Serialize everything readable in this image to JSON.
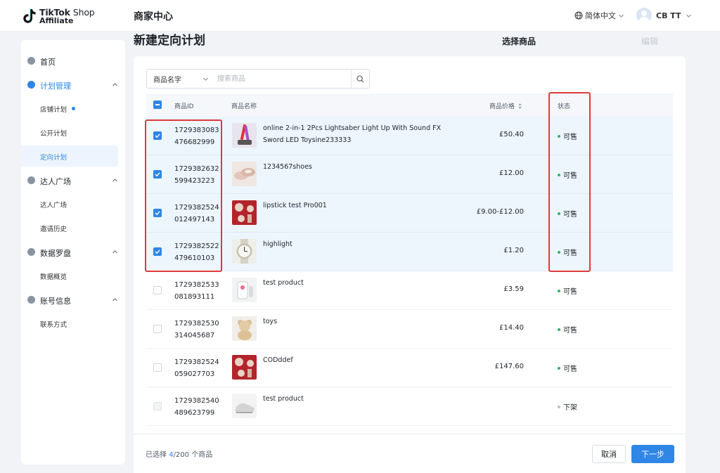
{
  "header": {
    "logo_line1_bold": "TikTok",
    "logo_line1_light": "Shop",
    "logo_line2": "Affiliate",
    "app_title": "商家中心",
    "language": "简体中文",
    "user_name": "CB TT"
  },
  "sidebar": {
    "home": "首页",
    "plan_mgmt": "计划管理",
    "plan_items": [
      "店铺计划",
      "公开计划",
      "定向计划"
    ],
    "creator_square": "达人广场",
    "creator_items": [
      "达人广场",
      "邀请历史"
    ],
    "data_compass": "数据罗盘",
    "data_items": [
      "数据概览"
    ],
    "account_info": "账号信息",
    "account_items": [
      "联系方式"
    ]
  },
  "page": {
    "title": "新建定向计划",
    "step_active": "选择商品",
    "step_next": "编辑"
  },
  "search": {
    "field_select": "商品名字",
    "placeholder": "搜索商品"
  },
  "table": {
    "headers": {
      "id": "商品ID",
      "name": "商品名称",
      "price": "商品价格",
      "status": "状态"
    },
    "rows": [
      {
        "id_line1": "1729383083",
        "id_line2": "476682999",
        "name": "online 2-in-1 2Pcs Lightsaber Light Up With Sound FX Sword LED Toysine233333",
        "price": "£50.40",
        "status": "可售",
        "selected": true
      },
      {
        "id_line1": "1729382632",
        "id_line2": "599423223",
        "name": "1234567shoes",
        "price": "£12.00",
        "status": "可售",
        "selected": true
      },
      {
        "id_line1": "1729382524",
        "id_line2": "012497143",
        "name": "lipstick test Pro001",
        "price": "£9.00-£12.00",
        "status": "可售",
        "selected": true
      },
      {
        "id_line1": "1729382522",
        "id_line2": "479610103",
        "name": "highlight",
        "price": "£1.20",
        "status": "可售",
        "selected": true
      },
      {
        "id_line1": "1729382533",
        "id_line2": "081893111",
        "name": "test product",
        "price": "£3.59",
        "status": "可售",
        "selected": false
      },
      {
        "id_line1": "1729382530",
        "id_line2": "314045687",
        "name": "toys",
        "price": "£14.40",
        "status": "可售",
        "selected": false
      },
      {
        "id_line1": "1729382524",
        "id_line2": "059027703",
        "name": "CODddef",
        "price": "£147.60",
        "status": "可售",
        "selected": false
      },
      {
        "id_line1": "1729382540",
        "id_line2": "489623799",
        "name": "test product",
        "price": "",
        "status": "下架",
        "selected": false
      }
    ]
  },
  "footer": {
    "selected_prefix": "已选择",
    "selected_count": "4",
    "selected_total": "/200",
    "selected_suffix": "个商品",
    "cancel": "取消",
    "next": "下一步"
  },
  "colors": {
    "accent": "#2f86e6",
    "available_dot": "#2fb36b",
    "delisted_dot": "#b8bdc4",
    "highlight_box": "#de3b3b"
  }
}
